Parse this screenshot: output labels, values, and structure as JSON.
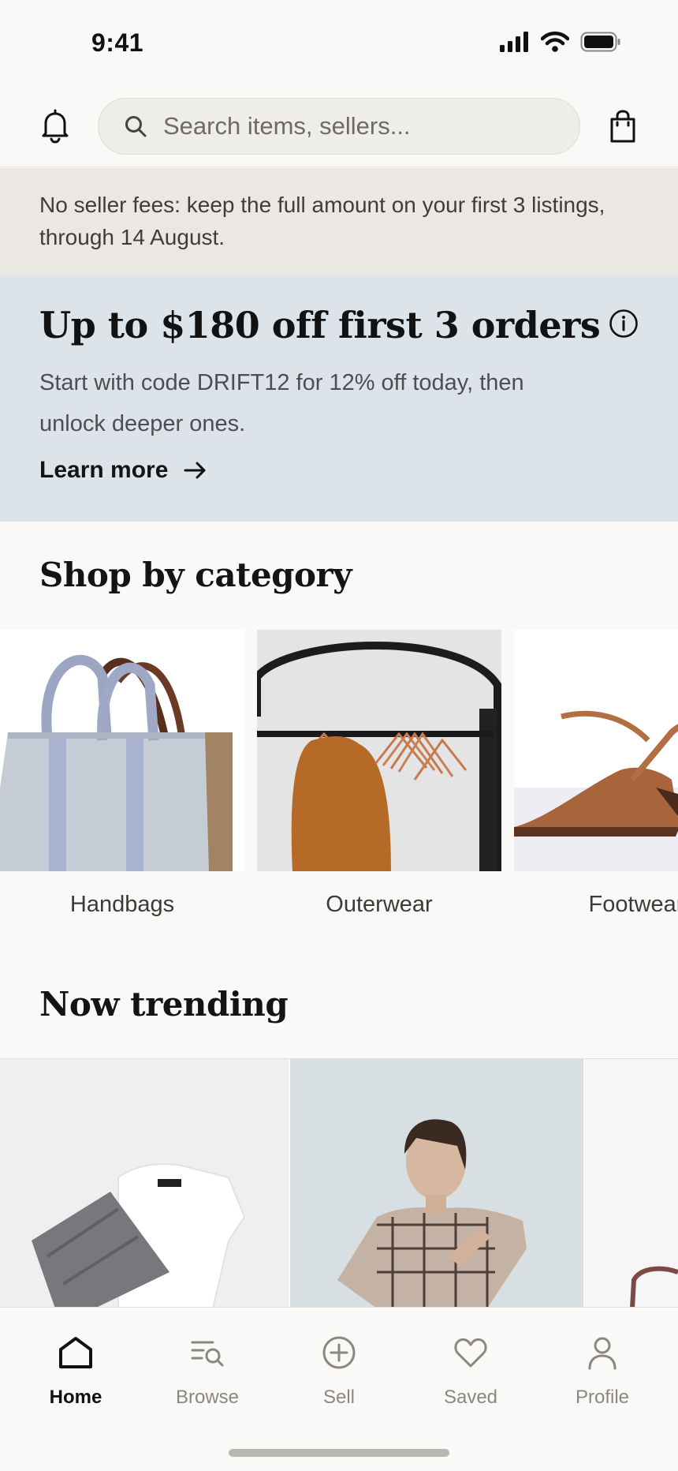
{
  "status_bar": {
    "time": "9:41"
  },
  "search": {
    "placeholder": "Search items, sellers..."
  },
  "fee_banner": {
    "text": "No seller fees: keep the full amount on your first 3 listings, through 14 August."
  },
  "promo": {
    "title": "Up to $180 off first 3 orders",
    "description": "Start with code DRIFT12 for 12% off today, then unlock deeper ones.",
    "link_label": "Learn more"
  },
  "categories": {
    "heading": "Shop by category",
    "items": [
      {
        "label": "Handbags"
      },
      {
        "label": "Outerwear"
      },
      {
        "label": "Footwear"
      }
    ]
  },
  "trending": {
    "heading": "Now trending"
  },
  "tab_bar": {
    "items": [
      {
        "label": "Home",
        "icon": "home-icon",
        "active": true
      },
      {
        "label": "Browse",
        "icon": "browse-icon",
        "active": false
      },
      {
        "label": "Sell",
        "icon": "plus-circle-icon",
        "active": false
      },
      {
        "label": "Saved",
        "icon": "heart-icon",
        "active": false
      },
      {
        "label": "Profile",
        "icon": "person-icon",
        "active": false
      }
    ]
  },
  "colors": {
    "page_bg": "#faf9f8",
    "fee_banner_bg": "#ebe8e3",
    "promo_bg": "#dce4e9",
    "search_bg": "#efede8"
  }
}
